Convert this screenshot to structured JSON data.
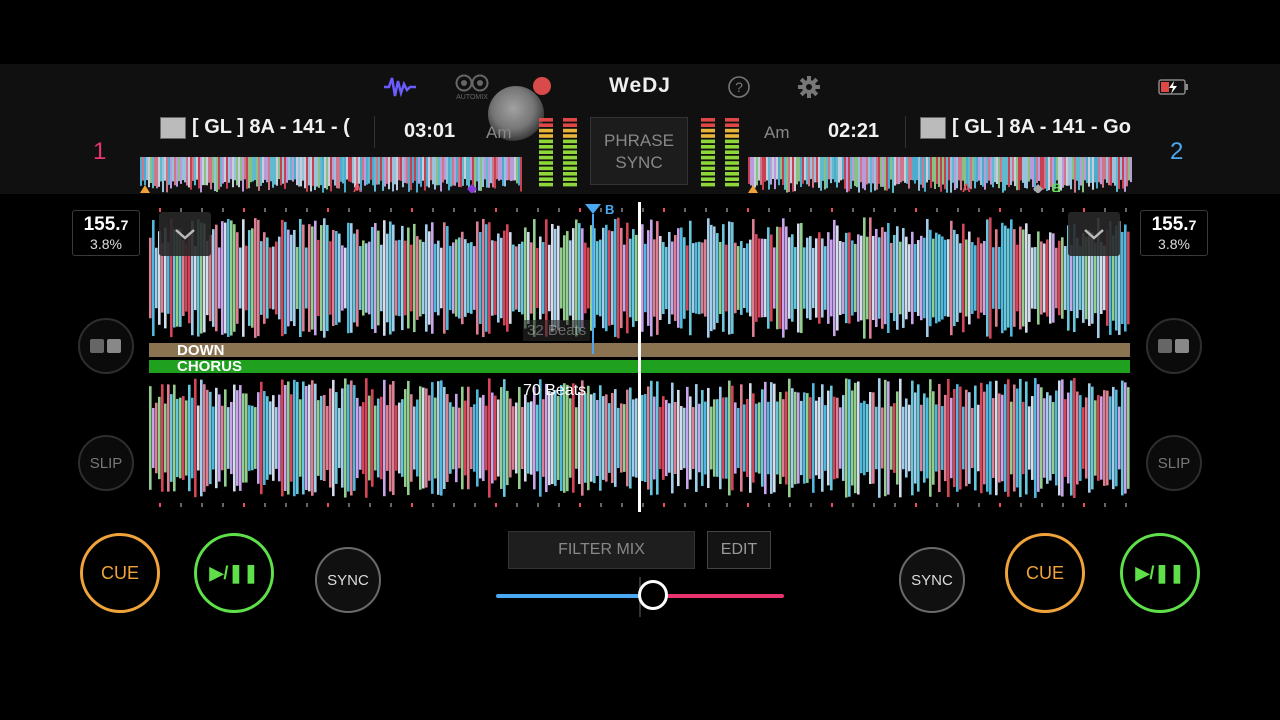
{
  "colors": {
    "deck1": "#e8336e",
    "deck2": "#4aa8f0",
    "cue": "#f0a33a",
    "play": "#5fe04a",
    "brand_icon": "#6b5cff",
    "record": "#e04848"
  },
  "header": {
    "app_title": "WeDJ",
    "automix_label": "AUTOMIX",
    "icons": [
      "waveform-icon",
      "automix-icon",
      "record-icon",
      "help-icon",
      "gear-icon",
      "battery-icon"
    ]
  },
  "deck1": {
    "number": "1",
    "title": "[ GL ] 8A - 141 - (",
    "time": "03:01",
    "key": "Am",
    "bpm_int": "155.",
    "bpm_dec": "7",
    "pitch": "3.8%",
    "slip": "SLIP",
    "cue": "CUE",
    "play": "▶/❚❚",
    "sync": "SYNC",
    "overview_marks": [
      "A",
      "B"
    ]
  },
  "deck2": {
    "number": "2",
    "title": "[ GL ] 8A - 141 - Go",
    "time": "02:21",
    "key": "Am",
    "bpm_int": "155.",
    "bpm_dec": "7",
    "pitch": "3.8%",
    "slip": "SLIP",
    "cue": "CUE",
    "play": "▶/❚❚",
    "sync": "SYNC",
    "overview_marks": [
      "A",
      "B"
    ]
  },
  "center": {
    "phrase_line1": "PHRASE",
    "phrase_line2": "SYNC",
    "filter_mix": "FILTER MIX",
    "edit": "EDIT",
    "crossfader_position": 0.55
  },
  "waveform": {
    "phrase_down": "DOWN",
    "phrase_chorus": "CHORUS",
    "beats_top": "32 Beats",
    "beats_bottom": "70 Beats",
    "hot_cue": "B"
  }
}
